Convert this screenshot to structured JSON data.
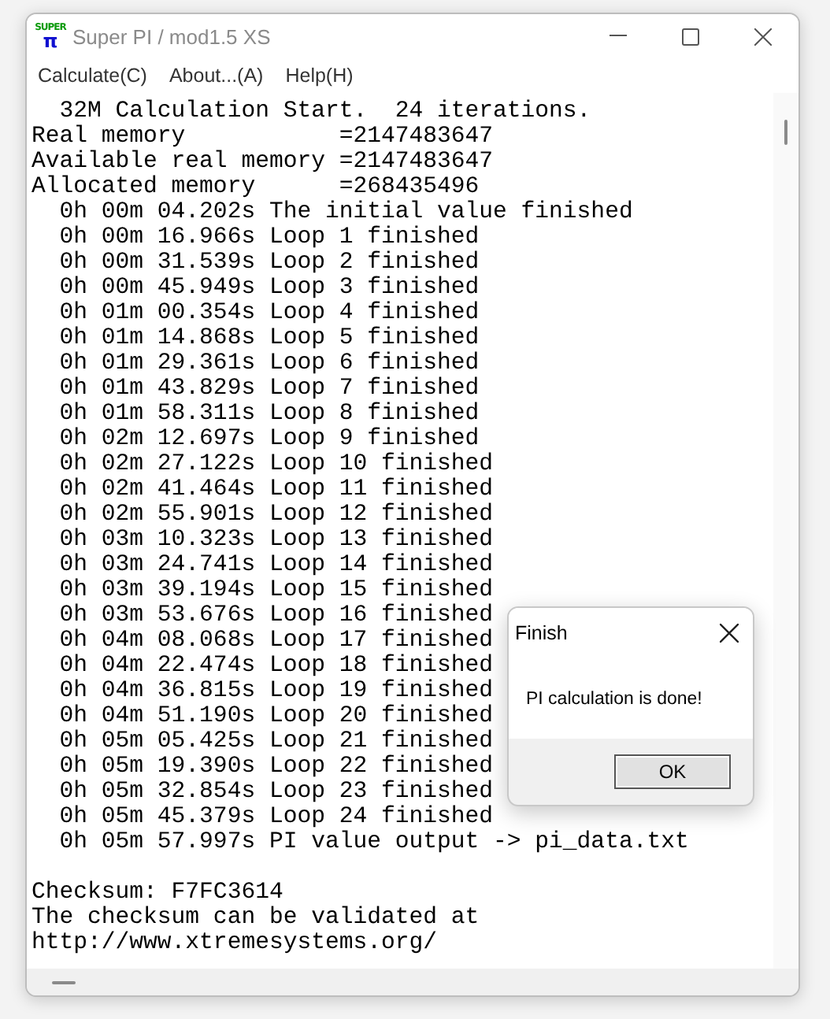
{
  "window": {
    "title": "Super PI / mod1.5 XS",
    "logo_top": "SUPER",
    "logo_bottom": "π"
  },
  "menu": [
    {
      "label": "Calculate(C)"
    },
    {
      "label": "About...(A)"
    },
    {
      "label": "Help(H)"
    }
  ],
  "log": [
    "  32M Calculation Start.  24 iterations.",
    "Real memory           =2147483647",
    "Available real memory =2147483647",
    "Allocated memory      =268435496",
    "  0h 00m 04.202s The initial value finished",
    "  0h 00m 16.966s Loop 1 finished",
    "  0h 00m 31.539s Loop 2 finished",
    "  0h 00m 45.949s Loop 3 finished",
    "  0h 01m 00.354s Loop 4 finished",
    "  0h 01m 14.868s Loop 5 finished",
    "  0h 01m 29.361s Loop 6 finished",
    "  0h 01m 43.829s Loop 7 finished",
    "  0h 01m 58.311s Loop 8 finished",
    "  0h 02m 12.697s Loop 9 finished",
    "  0h 02m 27.122s Loop 10 finished",
    "  0h 02m 41.464s Loop 11 finished",
    "  0h 02m 55.901s Loop 12 finished",
    "  0h 03m 10.323s Loop 13 finished",
    "  0h 03m 24.741s Loop 14 finished",
    "  0h 03m 39.194s Loop 15 finished",
    "  0h 03m 53.676s Loop 16 finished",
    "  0h 04m 08.068s Loop 17 finished",
    "  0h 04m 22.474s Loop 18 finished",
    "  0h 04m 36.815s Loop 19 finished",
    "  0h 04m 51.190s Loop 20 finished",
    "  0h 05m 05.425s Loop 21 finished",
    "  0h 05m 19.390s Loop 22 finished",
    "  0h 05m 32.854s Loop 23 finished",
    "  0h 05m 45.379s Loop 24 finished",
    "  0h 05m 57.997s PI value output -> pi_data.txt"
  ],
  "summary": [
    "Checksum: F7FC3614",
    "The checksum can be validated at",
    "http://www.xtremesystems.org/"
  ],
  "dialog": {
    "title": "Finish",
    "message": "PI calculation is done!",
    "button": "OK"
  }
}
